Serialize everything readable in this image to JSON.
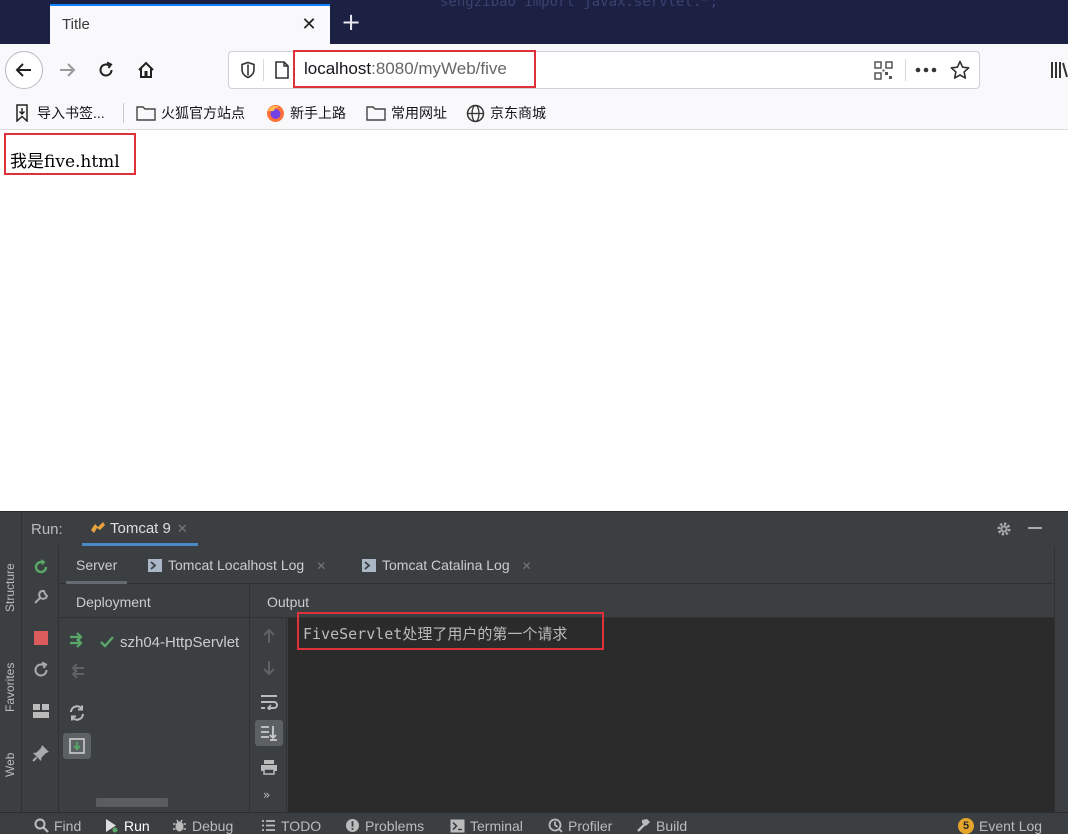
{
  "browser": {
    "tab_title": "Title",
    "tab_close": "✕",
    "new_tab": "+",
    "bg_code_text": "sengzibao   import javax.servlet.*;",
    "url_host": "localhost",
    "url_rest": ":8080/myWeb/five",
    "bookmarks": [
      {
        "label": "导入书签...",
        "icon": "import-icon"
      },
      {
        "label": "火狐官方站点",
        "icon": "folder-icon"
      },
      {
        "label": "新手上路",
        "icon": "firefox-icon"
      },
      {
        "label": "常用网址",
        "icon": "folder-icon"
      },
      {
        "label": "京东商城",
        "icon": "globe-icon"
      }
    ],
    "page_text": "我是five.html"
  },
  "ide": {
    "run_label": "Run:",
    "run_tab": "Tomcat 9",
    "sub_tabs": [
      "Server",
      "Tomcat Localhost Log",
      "Tomcat Catalina Log"
    ],
    "deployment_header": "Deployment",
    "output_header": "Output",
    "deployment_item": "szh04-HttpServlet",
    "console_output": "FiveServlet处理了用户的第一个请求",
    "left_strip": [
      "Structure",
      "Favorites",
      "Web"
    ],
    "status_items": [
      {
        "label": "Find",
        "icon": "search-icon"
      },
      {
        "label": "Run",
        "icon": "run-icon"
      },
      {
        "label": "Debug",
        "icon": "bug-icon"
      },
      {
        "label": "TODO",
        "icon": "list-icon"
      },
      {
        "label": "Problems",
        "icon": "problems-icon"
      },
      {
        "label": "Terminal",
        "icon": "terminal-icon"
      },
      {
        "label": "Profiler",
        "icon": "profiler-icon"
      },
      {
        "label": "Build",
        "icon": "hammer-icon"
      }
    ],
    "event_log": {
      "count": "5",
      "label": "Event Log"
    }
  },
  "colors": {
    "highlight_border": "#e0303a",
    "ide_bg": "#3c3f41",
    "console_bg": "#2b2b2b",
    "accent_blue": "#0a84ff"
  }
}
